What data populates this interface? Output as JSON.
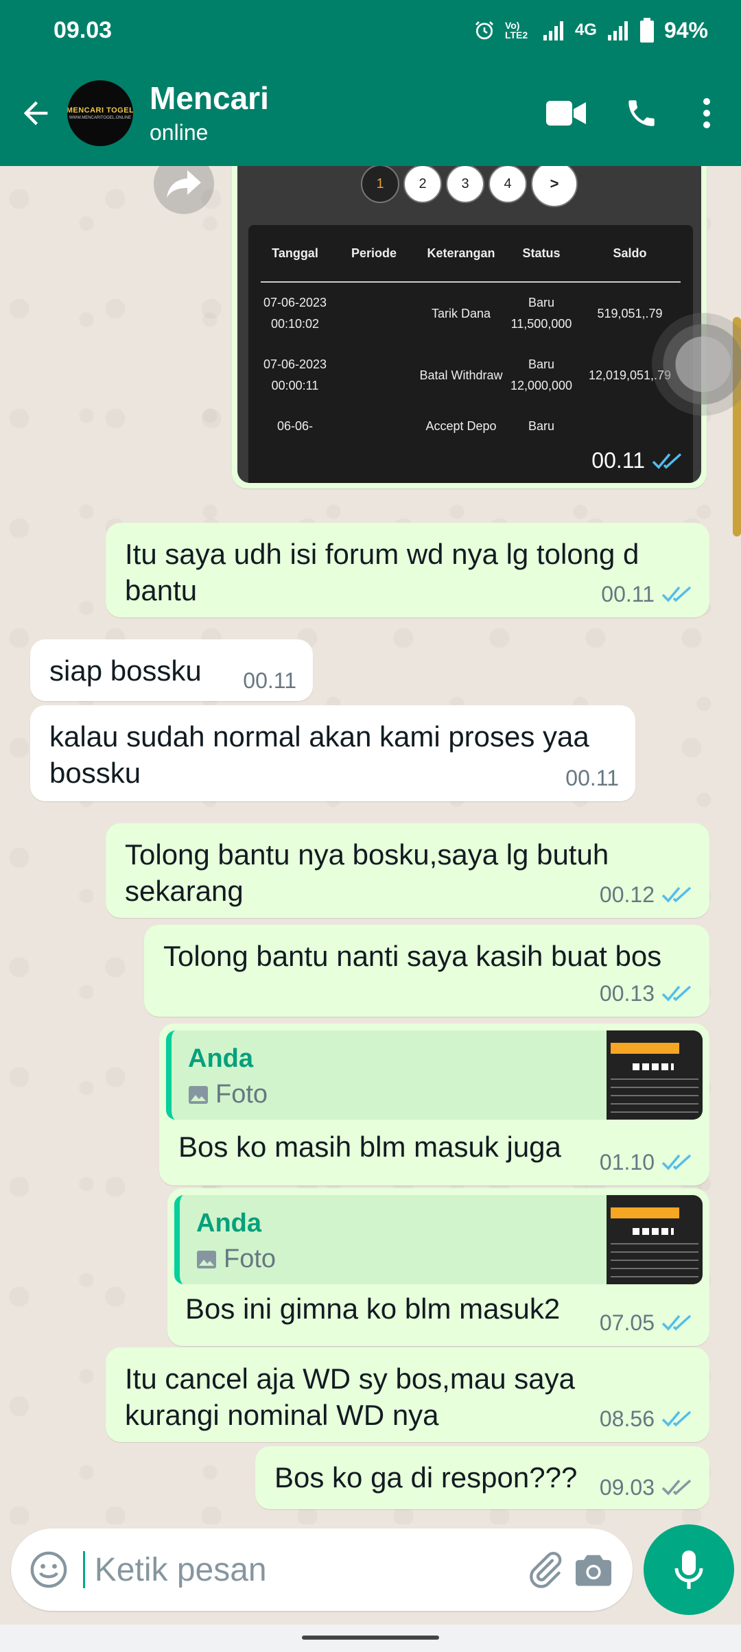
{
  "status_bar": {
    "time": "09.03",
    "network_label": "4G",
    "volte_label": "Vo) LTE2",
    "battery": "94%"
  },
  "header": {
    "contact_name": "Mencari",
    "contact_status": "online",
    "avatar_logo_text": "MENCARI TOGEL",
    "avatar_logo_sub": "WWW.MENCARITOGEL.ONLINE"
  },
  "image_message": {
    "pagination": [
      "1",
      "2",
      "3",
      "4",
      ">"
    ],
    "table_headers": [
      "Tanggal",
      "Periode",
      "Keterangan",
      "Status",
      "Saldo"
    ],
    "rows": [
      {
        "tanggal": "07-06-2023 00:10:02",
        "periode": "",
        "keterangan": "Tarik Dana",
        "status": "Baru 11,500,000",
        "saldo": "519,051,.79"
      },
      {
        "tanggal": "07-06-2023 00:00:11",
        "periode": "",
        "keterangan": "Batal Withdraw",
        "status": "Baru 12,000,000",
        "saldo": "12,019,051,.79"
      },
      {
        "tanggal": "06-06-",
        "periode": "",
        "keterangan": "Accept Depo",
        "status": "Baru",
        "saldo": ""
      }
    ],
    "time": "00.11"
  },
  "messages": [
    {
      "direction": "out",
      "text": "Itu saya udh isi forum wd nya lg tolong d bantu",
      "time": "00.11",
      "status": "read"
    },
    {
      "direction": "in",
      "text": "siap bossku",
      "time": "00.11"
    },
    {
      "direction": "in",
      "text": "kalau sudah normal akan kami proses yaa bossku",
      "time": "00.11"
    },
    {
      "direction": "out",
      "text": "Tolong bantu nya bosku,saya lg butuh sekarang",
      "time": "00.12",
      "status": "read"
    },
    {
      "direction": "out",
      "text": "Tolong bantu nanti saya kasih buat bos",
      "time": "00.13",
      "status": "read"
    },
    {
      "direction": "out",
      "quote_author": "Anda",
      "quote_type": "Foto",
      "text": "Bos ko masih blm masuk juga",
      "time": "01.10",
      "status": "read"
    },
    {
      "direction": "out",
      "quote_author": "Anda",
      "quote_type": "Foto",
      "text": "Bos ini gimna ko blm masuk2",
      "time": "07.05",
      "status": "read"
    },
    {
      "direction": "out",
      "text": "Itu cancel aja WD sy bos,mau saya kurangi nominal WD nya",
      "time": "08.56",
      "status": "read"
    },
    {
      "direction": "out",
      "text": "Bos ko ga di respon???",
      "time": "09.03",
      "status": "delivered"
    }
  ],
  "input": {
    "placeholder": "Ketik pesan"
  },
  "colors": {
    "header": "#008069",
    "outgoing_bubble": "#E7FFDB",
    "incoming_bubble": "#FFFFFF",
    "read_tick": "#53BDEB",
    "accent": "#00A884"
  },
  "icons": [
    "back-arrow-icon",
    "video-call-icon",
    "phone-icon",
    "more-options-icon",
    "forward-icon",
    "emoji-icon",
    "attach-icon",
    "camera-icon",
    "mic-icon",
    "photo-icon",
    "double-tick-icon",
    "alarm-icon",
    "signal-icon",
    "battery-icon"
  ]
}
